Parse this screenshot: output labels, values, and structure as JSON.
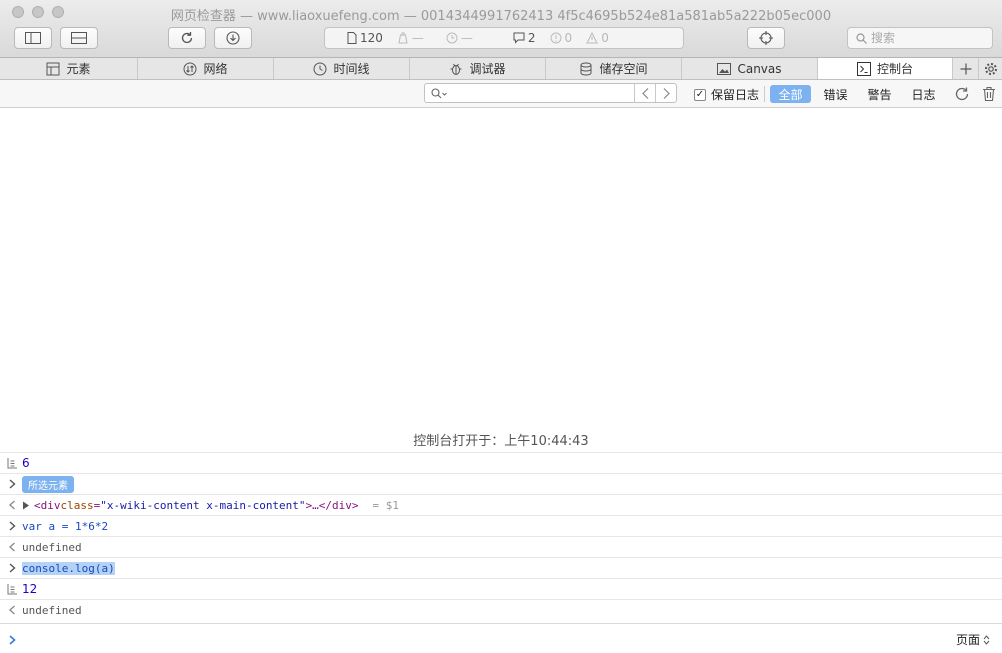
{
  "window": {
    "title": "网页检查器 — www.liaoxuefeng.com — 0014344991762413 4f5c4695b524e81a581ab5a222b05ec000"
  },
  "toolbar": {
    "activity": {
      "resources": "120",
      "resource_size": "—",
      "load_time": "—",
      "logs": "2",
      "errors": "0",
      "warnings": "0"
    },
    "search_placeholder": "搜索"
  },
  "tabs": [
    {
      "label": "元素",
      "icon": "elements-icon"
    },
    {
      "label": "网络",
      "icon": "network-icon"
    },
    {
      "label": "时间线",
      "icon": "timeline-icon"
    },
    {
      "label": "调试器",
      "icon": "debugger-icon"
    },
    {
      "label": "储存空间",
      "icon": "storage-icon"
    },
    {
      "label": "Canvas",
      "icon": "canvas-icon"
    },
    {
      "label": "控制台",
      "icon": "console-icon",
      "active": true
    }
  ],
  "filter": {
    "placeholder": "",
    "preserve_log": "保留日志",
    "preserve_checked": true,
    "levels": [
      "全部",
      "错误",
      "警告",
      "日志"
    ],
    "selected_level": "全部"
  },
  "console": {
    "opened_at": "控制台打开于：上午10:44:43",
    "messages": [
      {
        "kind": "log",
        "text": "6"
      },
      {
        "kind": "input",
        "badge": "所选元素"
      },
      {
        "kind": "output-element",
        "tag_open": "<div ",
        "attr": "class",
        "eq": "=",
        "value": "\"x-wiki-content x-main-content\"",
        "tail": ">…</div>",
        "var": "= $1"
      },
      {
        "kind": "input",
        "text": "var a = 1*6*2"
      },
      {
        "kind": "output",
        "text": "undefined"
      },
      {
        "kind": "input",
        "text": "console.log(a)"
      },
      {
        "kind": "log",
        "text": "12"
      },
      {
        "kind": "output",
        "text": "undefined"
      }
    ],
    "scope": "页面"
  },
  "colors": {
    "accent": "#7cb2ef",
    "number": "#1c00cf",
    "command": "#1849c0"
  }
}
